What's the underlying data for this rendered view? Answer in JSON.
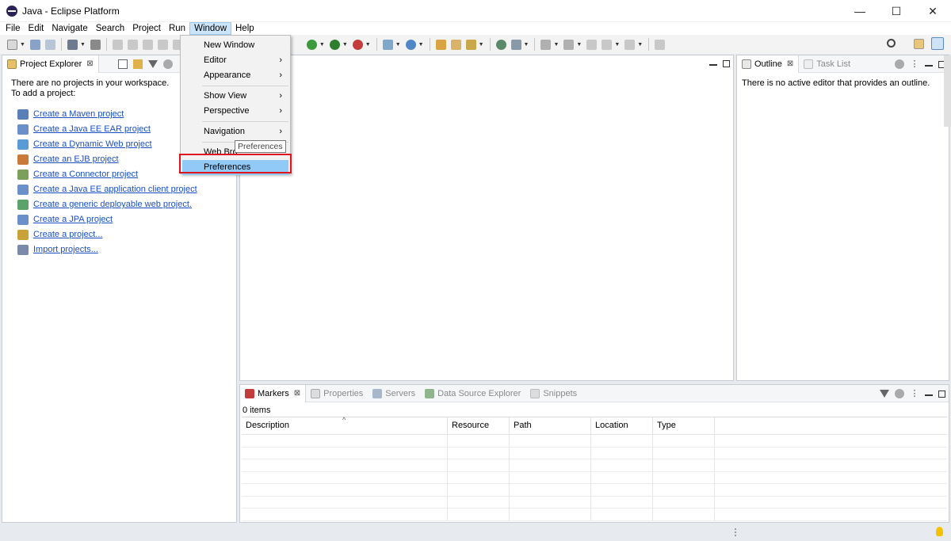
{
  "window": {
    "title": "Java - Eclipse Platform",
    "controls": [
      "—",
      "☐",
      "✕"
    ]
  },
  "menubar": {
    "items": [
      "File",
      "Edit",
      "Navigate",
      "Search",
      "Project",
      "Run",
      "Window",
      "Help"
    ],
    "active": "Window"
  },
  "window_menu": {
    "items": [
      {
        "label": "New Window",
        "submenu": false
      },
      {
        "label": "Editor",
        "submenu": true
      },
      {
        "label": "Appearance",
        "submenu": true
      },
      {
        "label": "Show View",
        "submenu": true
      },
      {
        "label": "Perspective",
        "submenu": true
      },
      {
        "label": "Navigation",
        "submenu": true
      },
      {
        "label": "Web Bro",
        "submenu": false
      },
      {
        "label": "Preferences",
        "submenu": false
      }
    ],
    "submenu_arrow": "›",
    "highlighted": "Preferences",
    "tooltip": "Preferences"
  },
  "project_explorer": {
    "tab_label": "Project Explorer",
    "close_glyph": "⊠",
    "intro_line1": "There are no projects in your workspace.",
    "intro_line2": "To add a project:",
    "links": [
      {
        "label": "Create a Maven project",
        "icon": "maven-icon",
        "color": "#5b7fb8"
      },
      {
        "label": "Create a Java EE EAR project",
        "icon": "ear-project-icon",
        "color": "#6a8fc9"
      },
      {
        "label": "Create a Dynamic Web project",
        "icon": "web-project-icon",
        "color": "#5b9bd5"
      },
      {
        "label": "Create an EJB project",
        "icon": "ejb-project-icon",
        "color": "#c97a3a"
      },
      {
        "label": "Create a Connector project",
        "icon": "connector-project-icon",
        "color": "#7aa05a"
      },
      {
        "label": "Create a Java EE application client project",
        "icon": "app-client-icon",
        "color": "#6a8fc9"
      },
      {
        "label": "Create a generic deployable web project.",
        "icon": "generic-web-icon",
        "color": "#5ba36b"
      },
      {
        "label": "Create a JPA project",
        "icon": "jpa-project-icon",
        "color": "#6a8fc9"
      },
      {
        "label": "Create a project...",
        "icon": "new-project-icon",
        "color": "#c9a23a"
      },
      {
        "label": "Import projects...",
        "icon": "import-icon",
        "color": "#7a8aa8"
      }
    ]
  },
  "outline": {
    "tab_label": "Outline",
    "task_list_label": "Task List",
    "message": "There is no active editor that provides an outline."
  },
  "bottom_panel": {
    "tabs": [
      {
        "label": "Markers",
        "active": true
      },
      {
        "label": "Properties",
        "active": false
      },
      {
        "label": "Servers",
        "active": false
      },
      {
        "label": "Data Source Explorer",
        "active": false
      },
      {
        "label": "Snippets",
        "active": false
      }
    ],
    "items_count": "0 items",
    "sort_glyph": "^",
    "columns": [
      "Description",
      "Resource",
      "Path",
      "Location",
      "Type"
    ],
    "empty_rows": 7
  },
  "colors": {
    "menu_highlight": "#91c9f7",
    "red_box": "#e0141e",
    "link": "#1a4fc4"
  }
}
